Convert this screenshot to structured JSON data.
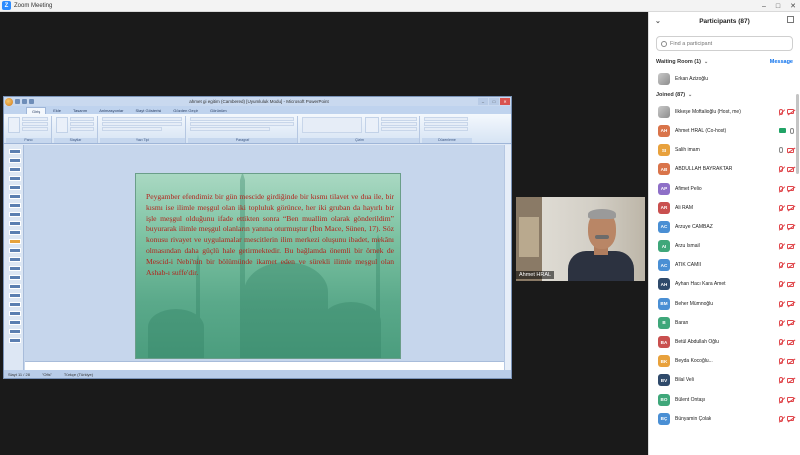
{
  "window": {
    "title": "Zoom Meeting",
    "logo": "Z",
    "controls": [
      "–",
      "□",
      "✕"
    ]
  },
  "ppt": {
    "doc_title": "ahmet gi egitim (Cambered) [Uyumluluk Modu] - Microsoft PowerPoint",
    "tabs": [
      "Giriş",
      "Ekle",
      "Tasarım",
      "Animasyonlar",
      "Slayt Gösterisi",
      "Gözden Geçir",
      "Görünüm"
    ],
    "groups": [
      "Pano",
      "Slaytlar",
      "Yazı Tipi",
      "Paragraf",
      "Çizim",
      "Düzenleme"
    ],
    "status": [
      "Slayt 11 / 28",
      "\"Ofis\"",
      "Türkçe (Türkiye)"
    ],
    "slide_text": "Peygamber efendimiz bir gün mescide girdiğinde bir kısmı tilavet ve dua ile, bir kısmı ise ilimle meşgul olan iki topluluk görünce, her iki gruban da hayırlı bir işle meşgul olduğunu ifade ettikten sonra “Ben muallim olarak gönderildim” buyurarak ilimle meşgul olanların yanına oturmuştur (İbn Mace, Sünen, 17). Söz konusu rivayet ve uygulamalar mescitlerin ilim merkezi oluşunu ibadet, mekânı olmasından daha güçlü hale getirmektedir. Bu bağlamda önemli bir örnek de Mescid-i Nebi'nin bir bölümünde ikamet eden ve sürekli ilimle meşgul olan Ashab-ı suffe'dir."
  },
  "camera": {
    "name": "Ahmet HRAL"
  },
  "participants": {
    "header": "Participants (87)",
    "search_placeholder": "Find a participant",
    "waiting_room": {
      "title": "Waiting Room (1)",
      "message_label": "Message",
      "people": [
        {
          "name": "Erkan Azizoğlu"
        }
      ]
    },
    "joined_title": "Joined (87)",
    "people": [
      {
        "name": "İlkkeşe Moftalioğlu (Host, me)",
        "initials": "",
        "color": "",
        "mic": "muted",
        "cam": "muted"
      },
      {
        "name": "Ahmet HRAL (Co-host)",
        "initials": "AH",
        "color": "#d9744a",
        "mic": "on",
        "cam": "on"
      },
      {
        "name": "Salih imam",
        "initials": "SI",
        "color": "#e8a13c",
        "mic": "on",
        "cam": "muted"
      },
      {
        "name": "ABDULLAH BAYRAKTAR",
        "initials": "AB",
        "color": "#d9744a",
        "mic": "muted",
        "cam": "muted"
      },
      {
        "name": "Afimet Pelio",
        "initials": "AP",
        "color": "#8e6fc7",
        "mic": "muted",
        "cam": "muted"
      },
      {
        "name": "Ali RAM",
        "initials": "AR",
        "color": "#c9504f",
        "mic": "muted",
        "cam": "muted"
      },
      {
        "name": "Arzuye CAMBAZ",
        "initials": "AC",
        "color": "#4a8fd4",
        "mic": "muted",
        "cam": "muted"
      },
      {
        "name": "Arzu İsmail",
        "initials": "AI",
        "color": "#3fa77a",
        "mic": "muted",
        "cam": "muted"
      },
      {
        "name": "ATİK CAMİİ",
        "initials": "AC",
        "color": "#4a8fd4",
        "mic": "muted",
        "cam": "muted"
      },
      {
        "name": "Ayhan Hacı Kara Amet",
        "initials": "AH",
        "color": "#2f4a6b",
        "mic": "muted",
        "cam": "muted"
      },
      {
        "name": "Beher Mümnoğlu",
        "initials": "BM",
        "color": "#4a8fd4",
        "mic": "muted",
        "cam": "muted"
      },
      {
        "name": "Baran",
        "initials": "B",
        "color": "#3fa77a",
        "mic": "muted",
        "cam": "muted"
      },
      {
        "name": "Betül Abdullah Oğlu",
        "initials": "BA",
        "color": "#c9504f",
        "mic": "muted",
        "cam": "muted"
      },
      {
        "name": "Beyda Kocoğlu...",
        "initials": "BK",
        "color": "#e8a13c",
        "mic": "muted",
        "cam": "muted"
      },
      {
        "name": "Bilal Veli",
        "initials": "BV",
        "color": "#2f4a6b",
        "mic": "muted",
        "cam": "muted"
      },
      {
        "name": "Bülent Ontaşı",
        "initials": "BO",
        "color": "#3fa77a",
        "mic": "muted",
        "cam": "muted"
      },
      {
        "name": "Bünyamin Çolak",
        "initials": "BÇ",
        "color": "#4a8fd4",
        "mic": "muted",
        "cam": "muted"
      }
    ]
  }
}
